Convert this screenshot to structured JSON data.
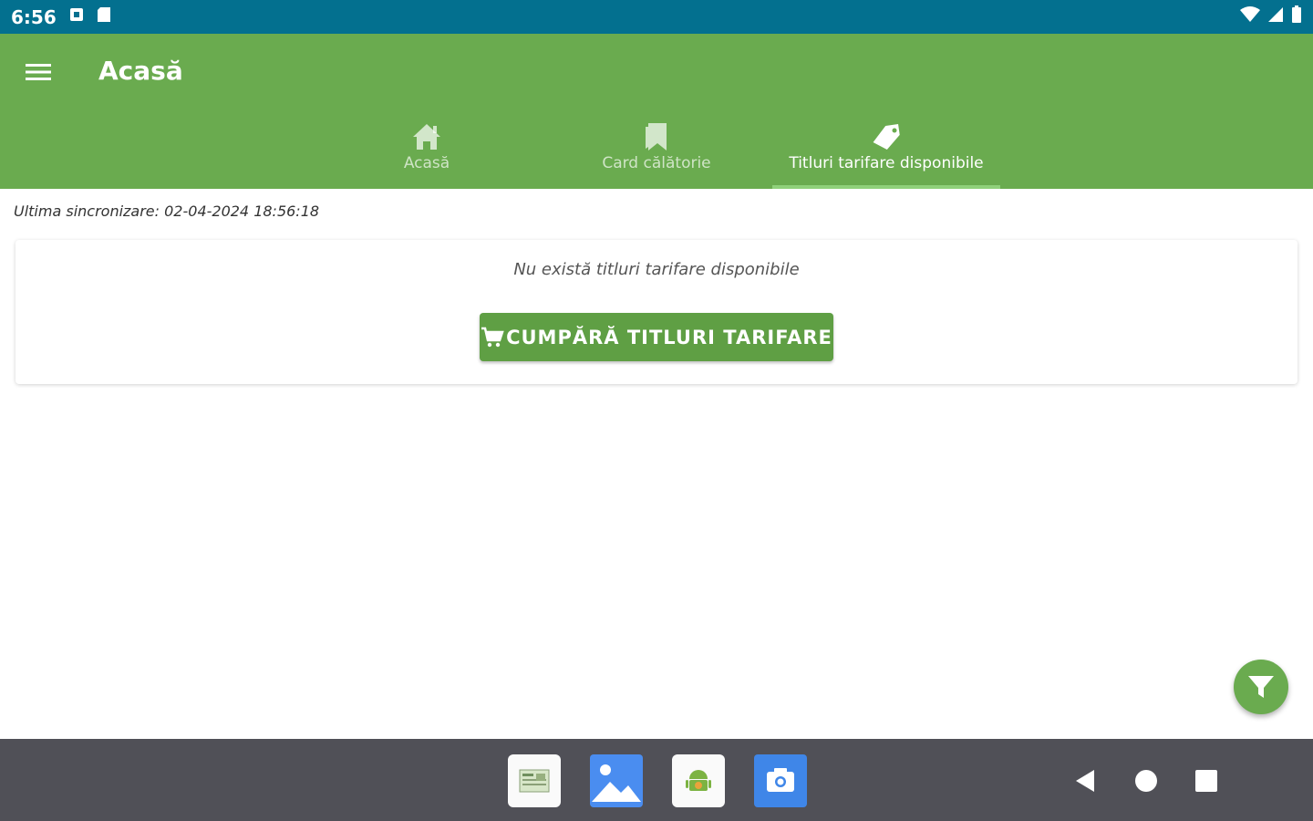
{
  "status_bar": {
    "time": "6:56"
  },
  "app_bar": {
    "title": "Acasă",
    "tabs": [
      {
        "label": "Acasă",
        "icon": "home-icon",
        "active": false
      },
      {
        "label": "Card călătorie",
        "icon": "bookmark-icon",
        "active": false
      },
      {
        "label": "Titluri tarifare disponibile",
        "icon": "tag-icon",
        "active": true
      }
    ]
  },
  "main": {
    "sync_text": "Ultima sincronizare: 02-04-2024 18:56:18",
    "empty_message": "Nu există titluri tarifare disponibile",
    "buy_button_label": "CUMPĂRĂ TITLURI TARIFARE"
  },
  "colors": {
    "status_bar": "#03708f",
    "app_bar": "#6aab4f",
    "button": "#5f9f44",
    "nav_bar": "#505057"
  },
  "dock": {
    "apps": [
      "sheet-app-icon",
      "gallery-app-icon",
      "android-app-icon",
      "camera-app-icon"
    ]
  }
}
